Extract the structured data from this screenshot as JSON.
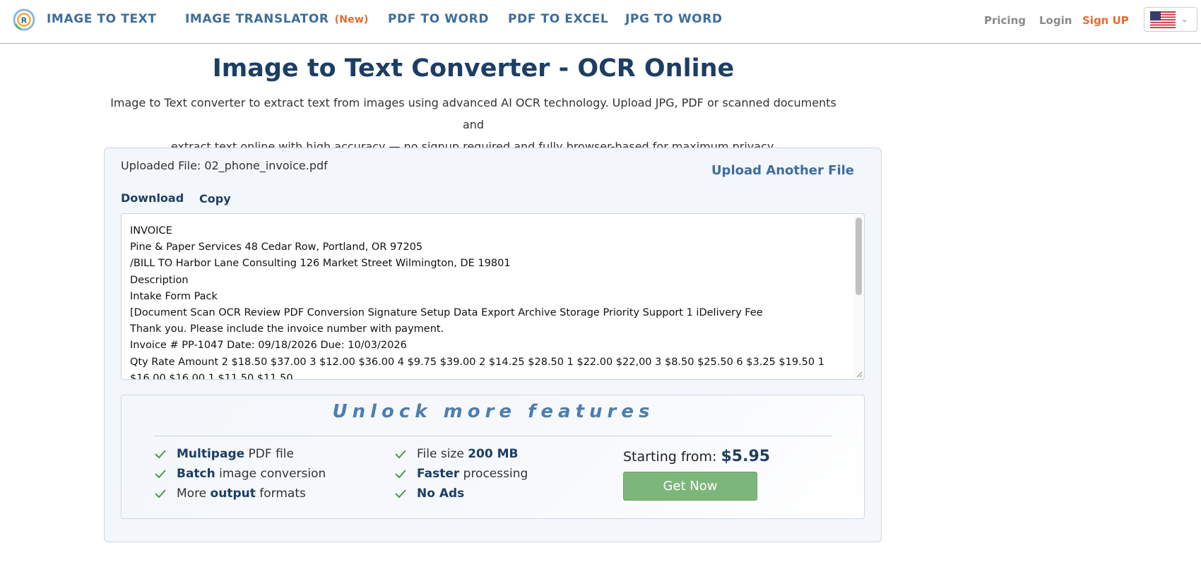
{
  "colors": {
    "brand_blue": "#3d6d9b",
    "navy": "#1d3e64",
    "accent_orange": "#e86a2d",
    "button_green": "#7db67a",
    "check_green": "#4a9a4a"
  },
  "header": {
    "brand": "IMAGE TO TEXT",
    "logo_icon": "ocr-logo-icon",
    "nav": [
      {
        "label": "IMAGE TRANSLATOR",
        "badge": "(New)"
      },
      {
        "label": "PDF TO WORD"
      },
      {
        "label": "PDF TO EXCEL"
      },
      {
        "label": "JPG TO WORD"
      }
    ],
    "pricing": "Pricing",
    "login": "Login",
    "signup": "Sign UP",
    "language_icon": "us-flag-icon",
    "language_chevron": "chevron-down-icon"
  },
  "hero": {
    "title": "Image to Text Converter - OCR Online",
    "description_line1": "Image to Text converter to extract text from images using advanced AI OCR technology. Upload JPG, PDF or scanned documents and",
    "description_line2": "extract text online with high accuracy — no signup required and fully browser-based for maximum privacy."
  },
  "result": {
    "uploaded_file": "Uploaded File: 02_phone_invoice.pdf",
    "upload_another": "Upload Another File",
    "download": "Download",
    "copy": "Copy",
    "text_lines": [
      "INVOICE",
      "Pine & Paper Services 48 Cedar Row, Portland, OR 97205",
      "/BILL TO Harbor Lane Consulting 126 Market Street Wilmington, DE 19801",
      "Description",
      "Intake Form Pack",
      "[Document Scan OCR Review PDF Conversion Signature Setup Data Export Archive Storage Priority Support 1 iDelivery Fee",
      "Thank you. Please include the invoice number with payment.",
      "Invoice # PP-1047 Date: 09/18/2026 Due: 10/03/2026",
      "Qty Rate Amount 2 $18.50 $37.00 3 $12.00 $36.00 4 $9.75 $39.00 2 $14.25 $28.50 1 $22.00 $22,00 3 $8.50 $25.50 6 $3.25 $19.50 1",
      "$16.00 $16.00 1 $11.50 $11.50"
    ]
  },
  "unlock": {
    "title": "Unlock more features",
    "check_icon": "checkmark-icon",
    "features_col1": [
      {
        "bold": "Multipage",
        "rest": " PDF file"
      },
      {
        "bold": "Batch",
        "rest": " image conversion"
      },
      {
        "pre": "More ",
        "bold": "output",
        "rest": " formats"
      }
    ],
    "features_col2": [
      {
        "pre": "File size ",
        "bold": "200 MB"
      },
      {
        "bold": "Faster",
        "rest": " processing"
      },
      {
        "bold": "No Ads"
      }
    ],
    "starting_from": "Starting from: ",
    "price": "$5.95",
    "cta": "Get Now"
  }
}
